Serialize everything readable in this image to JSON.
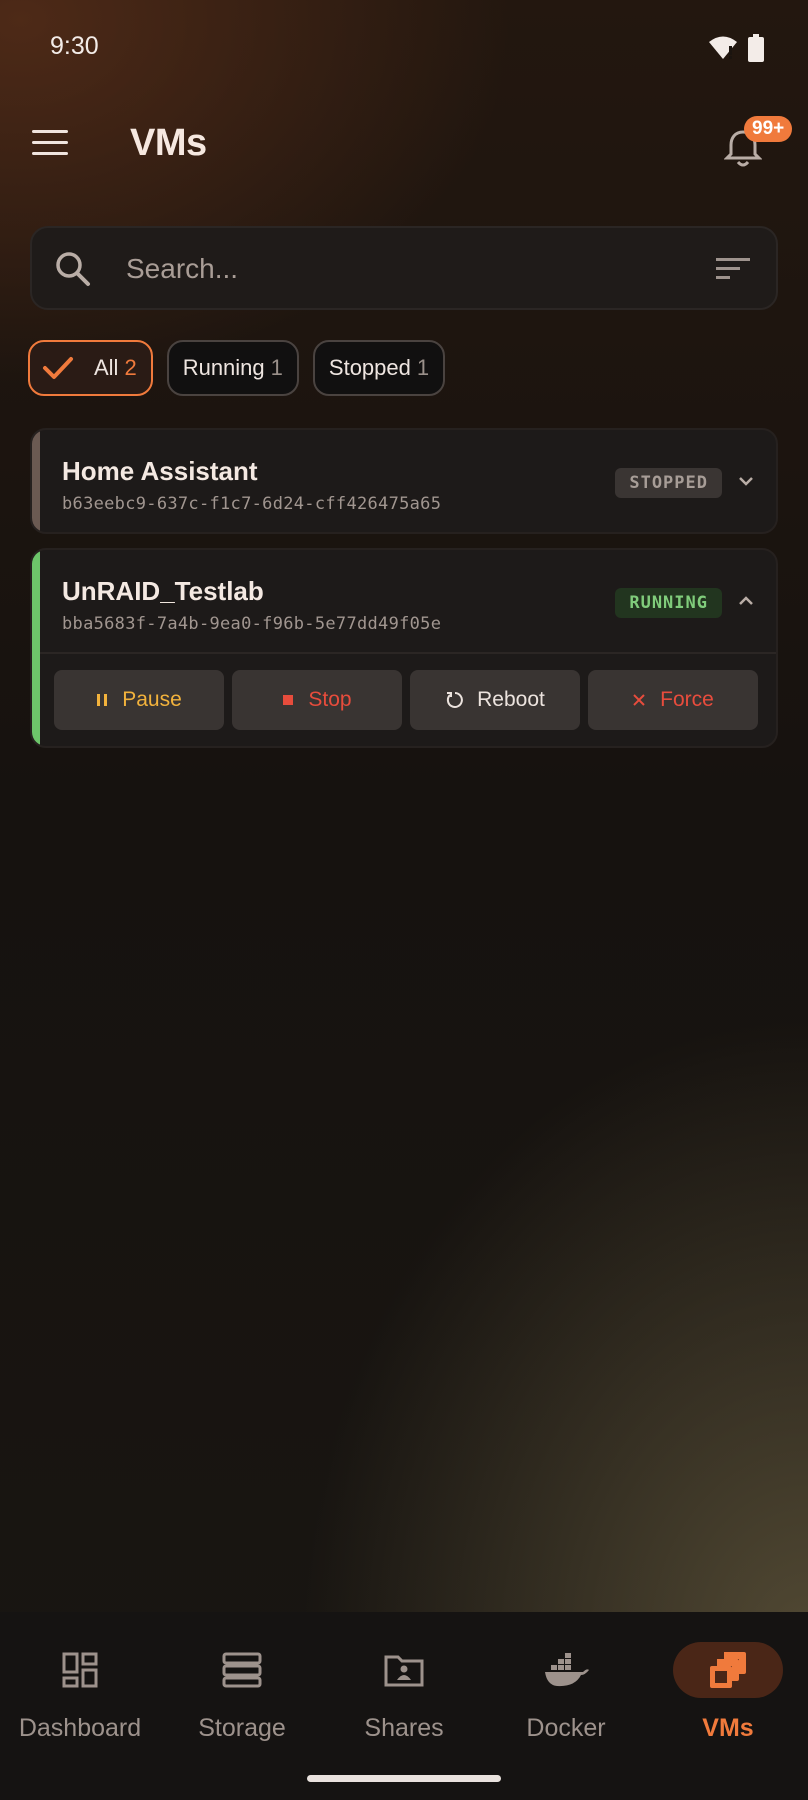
{
  "status_bar": {
    "time": "9:30"
  },
  "app_bar": {
    "title": "VMs",
    "notification_badge": "99+"
  },
  "search": {
    "placeholder": "Search..."
  },
  "filters": [
    {
      "label": "All",
      "count": "2",
      "selected": true
    },
    {
      "label": "Running",
      "count": "1",
      "selected": false
    },
    {
      "label": "Stopped",
      "count": "1",
      "selected": false
    }
  ],
  "vms": [
    {
      "name": "Home Assistant",
      "uuid": "b63eebc9-637c-f1c7-6d24-cff426475a65",
      "status": "STOPPED",
      "expanded": false,
      "stripe_color": "#6b5a52"
    },
    {
      "name": "UnRAID_Testlab",
      "uuid": "bba5683f-7a4b-9ea0-f96b-5e77dd49f05e",
      "status": "RUNNING",
      "expanded": true,
      "stripe_color": "#6dc56a",
      "actions": {
        "pause": "Pause",
        "stop": "Stop",
        "reboot": "Reboot",
        "force": "Force"
      }
    }
  ],
  "bottom_nav": [
    {
      "label": "Dashboard",
      "icon": "dashboard-icon",
      "active": false
    },
    {
      "label": "Storage",
      "icon": "storage-icon",
      "active": false
    },
    {
      "label": "Shares",
      "icon": "shares-folder-icon",
      "active": false
    },
    {
      "label": "Docker",
      "icon": "docker-icon",
      "active": false
    },
    {
      "label": "VMs",
      "icon": "vms-icon",
      "active": true
    }
  ],
  "colors": {
    "accent": "#f07a3c",
    "running": "#80cc7b",
    "stopped": "#a79d97",
    "danger": "#e74c3c",
    "warning": "#f2b23c"
  }
}
